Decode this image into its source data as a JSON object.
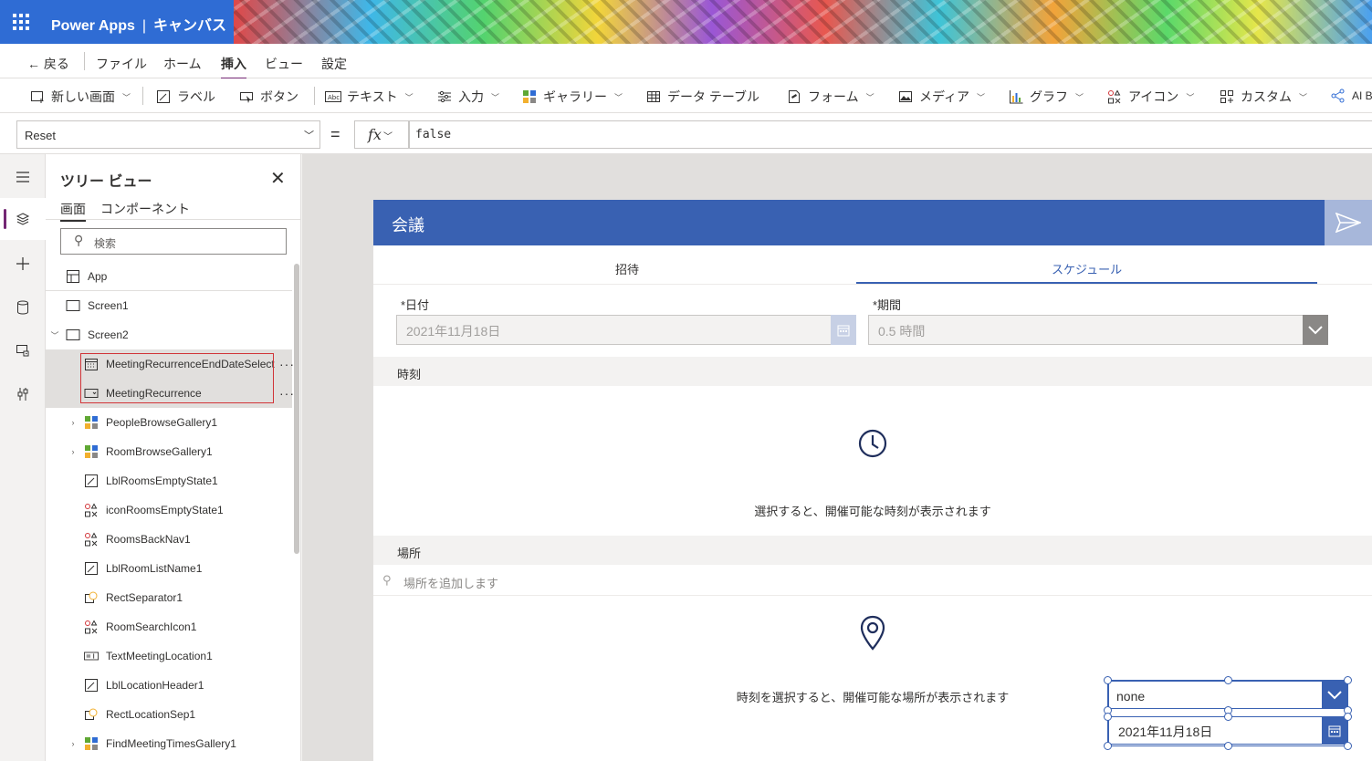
{
  "header": {
    "app_name": "Power Apps",
    "separator": "|",
    "context": "キャンバス"
  },
  "menubar": {
    "back": "戻る",
    "items": [
      "ファイル",
      "ホーム",
      "挿入",
      "ビュー",
      "設定"
    ],
    "active": "挿入"
  },
  "ribbon": {
    "new_screen": "新しい画面",
    "label": "ラベル",
    "button": "ボタン",
    "text": "テキスト",
    "input": "入力",
    "gallery": "ギャラリー",
    "data_table": "データ テーブル",
    "form": "フォーム",
    "media": "メディア",
    "chart": "グラフ",
    "icons": "アイコン",
    "custom": "カスタム",
    "ai": "AI B"
  },
  "formula": {
    "property": "Reset",
    "equals": "=",
    "fx": "fx",
    "value": "false"
  },
  "tree": {
    "title": "ツリー ビュー",
    "tabs": [
      "画面",
      "コンポーネント"
    ],
    "search_placeholder": "検索",
    "items": [
      {
        "label": "App",
        "icon": "app-icon"
      },
      {
        "label": "Screen1",
        "icon": "screen-icon"
      },
      {
        "label": "Screen2",
        "icon": "screen-icon"
      },
      {
        "label": "MeetingRecurrenceEndDateSelect",
        "icon": "date-picker-icon"
      },
      {
        "label": "MeetingRecurrence",
        "icon": "dropdown-icon"
      },
      {
        "label": "PeopleBrowseGallery1",
        "icon": "gallery-icon"
      },
      {
        "label": "RoomBrowseGallery1",
        "icon": "gallery-icon"
      },
      {
        "label": "LblRoomsEmptyState1",
        "icon": "label-icon"
      },
      {
        "label": "iconRoomsEmptyState1",
        "icon": "icon-control-icon"
      },
      {
        "label": "RoomsBackNav1",
        "icon": "icon-control-icon"
      },
      {
        "label": "LblRoomListName1",
        "icon": "label-icon"
      },
      {
        "label": "RectSeparator1",
        "icon": "shape-icon"
      },
      {
        "label": "RoomSearchIcon1",
        "icon": "icon-control-icon"
      },
      {
        "label": "TextMeetingLocation1",
        "icon": "text-input-icon"
      },
      {
        "label": "LblLocationHeader1",
        "icon": "label-icon"
      },
      {
        "label": "RectLocationSep1",
        "icon": "shape-icon"
      },
      {
        "label": "FindMeetingTimesGallery1",
        "icon": "gallery-icon"
      }
    ],
    "more": "···"
  },
  "app": {
    "title": "会議",
    "tabs": [
      "招待",
      "スケジュール"
    ],
    "active_tab": "スケジュール",
    "date_label": "*日付",
    "date_value": "2021年11月18日",
    "duration_label": "*期間",
    "duration_value": "0.5 時間",
    "time_section": "時刻",
    "time_hint": "選択すると、開催可能な時刻が表示されます",
    "location_section": "場所",
    "location_placeholder": "場所を追加します",
    "location_hint": "時刻を選択すると、開催可能な場所が表示されます",
    "recurrence_value": "none",
    "recurrence_end_date": "2021年11月18日"
  },
  "colors": {
    "header": "#2f6cd4",
    "accent": "#742774",
    "app_blue": "#3961b2"
  }
}
